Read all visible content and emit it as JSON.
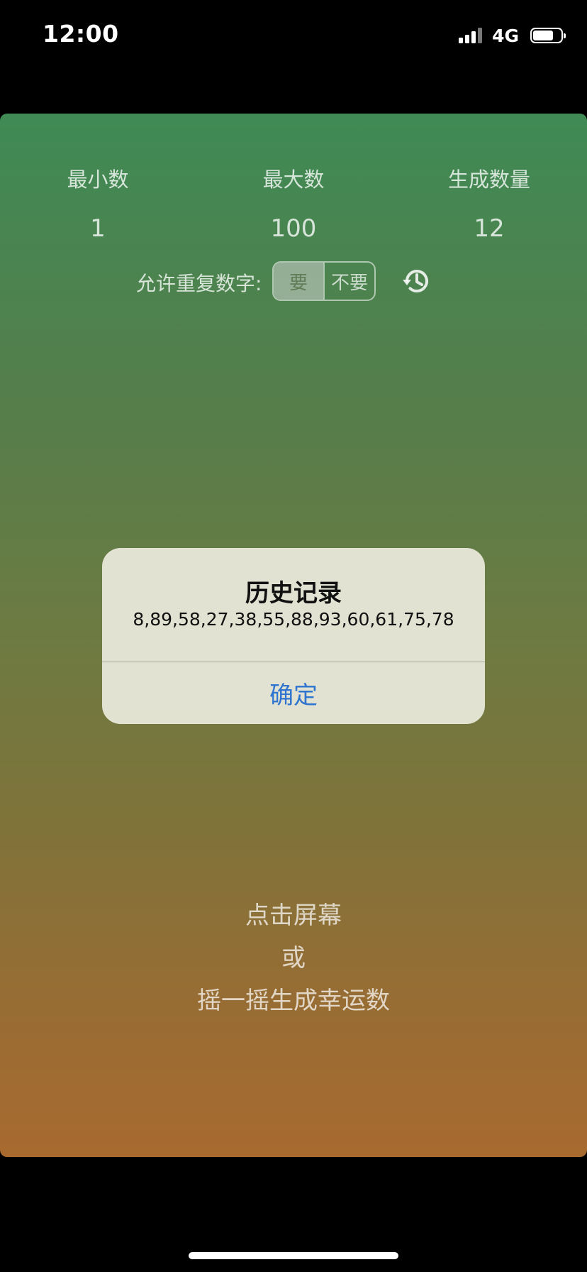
{
  "status_bar": {
    "time": "12:00",
    "network": "4G",
    "battery_level": 0.7
  },
  "settings": {
    "min_label": "最小数",
    "min_value": "1",
    "max_label": "最大数",
    "max_value": "100",
    "count_label": "生成数量",
    "count_value": "12"
  },
  "repeat": {
    "label": "允许重复数字:",
    "options": [
      "要",
      "不要"
    ],
    "selected": "要"
  },
  "history_icon": "history-clock-icon",
  "hint": {
    "line1": "点击屏幕",
    "line2": "或",
    "line3": "摇一摇生成幸运数"
  },
  "alert": {
    "title": "历史记录",
    "message": "8,89,58,27,38,55,88,93,60,61,75,78",
    "confirm_label": "确定"
  },
  "colors": {
    "gradient_top": "#3f8a55",
    "gradient_bottom": "#a86a2f",
    "alert_button": "#2f74d0"
  }
}
